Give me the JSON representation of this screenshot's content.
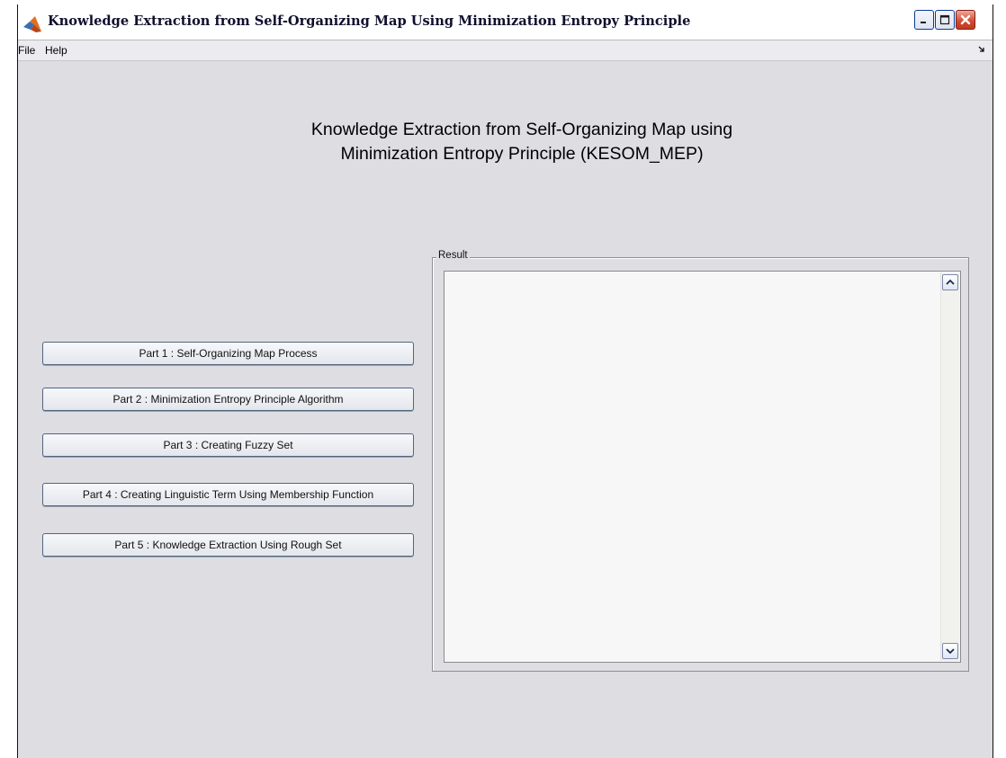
{
  "window": {
    "title": "Knowledge Extraction from Self-Organizing Map Using Minimization Entropy Principle"
  },
  "menu": {
    "items": [
      {
        "label": "File"
      },
      {
        "label": "Help"
      }
    ]
  },
  "heading": {
    "line1": "Knowledge Extraction from Self-Organizing Map using",
    "line2": "Minimization Entropy Principle (KESOM_MEP)"
  },
  "buttons": [
    {
      "label": "Part 1 : Self-Organizing Map Process"
    },
    {
      "label": "Part 2 : Minimization Entropy Principle Algorithm"
    },
    {
      "label": "Part 3 : Creating Fuzzy Set"
    },
    {
      "label": "Part 4 : Creating Linguistic Term Using Membership Function"
    },
    {
      "label": "Part 5 : Knowledge Extraction Using Rough Set"
    }
  ],
  "result": {
    "label": "Result",
    "content": ""
  },
  "icons": {
    "app": "matlab-logo-icon",
    "minimize": "minimize-icon",
    "maximize": "maximize-icon",
    "close": "close-icon",
    "undock": "undock-arrow-icon",
    "scroll_up": "chevron-up-icon",
    "scroll_down": "chevron-down-icon"
  },
  "colors": {
    "background": "#dedde2",
    "close_button": "#d0492f",
    "button_border": "#52657e"
  }
}
